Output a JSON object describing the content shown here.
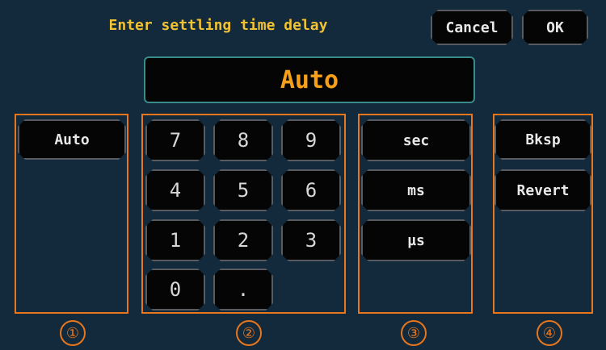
{
  "header": {
    "title": "Enter settling time delay",
    "cancel_label": "Cancel",
    "ok_label": "OK"
  },
  "display": {
    "value": "Auto"
  },
  "group1": {
    "auto_label": "Auto",
    "marker": "①"
  },
  "keypad": {
    "keys": [
      "7",
      "8",
      "9",
      "4",
      "5",
      "6",
      "1",
      "2",
      "3",
      "0",
      "."
    ],
    "marker": "②"
  },
  "units": {
    "sec": "sec",
    "ms": "ms",
    "us": "µs",
    "marker": "③"
  },
  "edit": {
    "bksp": "Bksp",
    "revert": "Revert",
    "marker": "④"
  },
  "colors": {
    "background": "#132a3d",
    "title": "#f1c232",
    "display_text": "#f6a01a",
    "group_border": "#e8761c",
    "display_border": "#3a8c8c"
  }
}
